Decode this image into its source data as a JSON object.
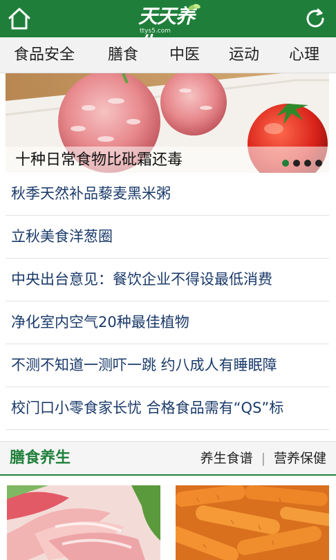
{
  "header": {
    "logo_text": "天天养生",
    "logo_domain": "ttys5.com",
    "home_icon": "home-icon",
    "refresh_icon": "refresh-icon",
    "bg_color": "#1f7f3a"
  },
  "nav": {
    "items": [
      {
        "label": "食品安全"
      },
      {
        "label": "膳食"
      },
      {
        "label": "中医"
      },
      {
        "label": "运动"
      },
      {
        "label": "心理"
      }
    ]
  },
  "banner": {
    "caption": "十种日常食物比砒霜还毒",
    "slide_count": 4,
    "active_slide": 1
  },
  "news": [
    {
      "title": "秋季天然补品藜麦黑米粥"
    },
    {
      "title": "立秋美食洋葱圈"
    },
    {
      "title": "中央出台意见：餐饮企业不得设最低消费"
    },
    {
      "title": "净化室内空气20种最佳植物"
    },
    {
      "title": "不测不知道一测吓一跳 约八成人有睡眠障"
    },
    {
      "title": "校门口小零食家长忧 合格食品需有“QS”标"
    }
  ],
  "section": {
    "title": "膳食养生",
    "links": [
      {
        "label": "养生食谱"
      },
      {
        "label": "营养保健"
      }
    ],
    "separator": "|"
  }
}
